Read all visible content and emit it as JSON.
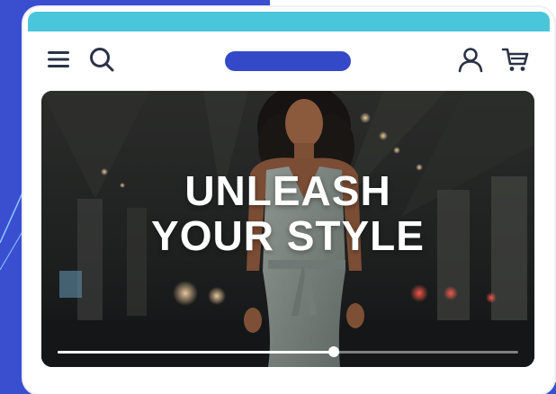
{
  "header": {
    "menu_icon": "hamburger-menu-icon",
    "search_icon": "search-icon",
    "account_icon": "user-icon",
    "cart_icon": "shopping-cart-icon"
  },
  "hero": {
    "headline_line1": "UNLEASH",
    "headline_line2": "YOUR STYLE",
    "progress_fraction": 0.6
  },
  "colors": {
    "background_blue": "#3a4fd0",
    "top_bar": "#4ac6da",
    "logo_pill": "#3449c7",
    "icon": "#2a3346"
  }
}
